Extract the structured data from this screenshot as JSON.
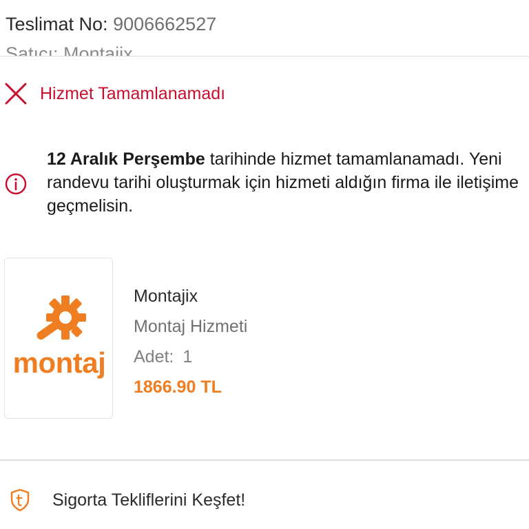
{
  "header": {
    "delivery_label": "Teslimat No:",
    "delivery_number": "9006662527",
    "seller_line": "Satıcı: Montajix"
  },
  "status": {
    "icon": "close-icon",
    "text": "Hizmet Tamamlanamadı",
    "color": "#c8102e"
  },
  "info": {
    "icon": "info-circle-icon",
    "date_bold": "12 Aralık Perşembe",
    "message": " tarihinde hizmet tamamlanamadı. Yeni randevu tarihi oluşturmak için hizmeti aldığın firma ile iletişime geçmelisin."
  },
  "product": {
    "logo_text": "montaj",
    "logo_icon": "gear-wrench-icon",
    "seller": "Montajix",
    "type": "Montaj Hizmeti",
    "qty_label": "Adet:",
    "qty_value": "1",
    "price": "1866.90 TL",
    "accent_color": "#ef7d22"
  },
  "insurance": {
    "icon": "shield-icon",
    "text": "Sigorta Tekliflerini Keşfet!"
  }
}
